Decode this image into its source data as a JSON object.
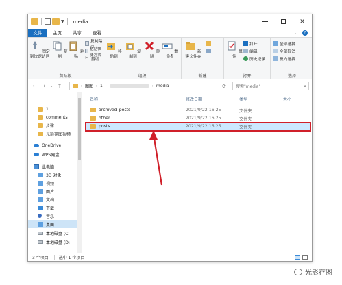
{
  "window": {
    "title": "media",
    "controls": {
      "minimize": "–",
      "maximize": "□",
      "close": "✕"
    }
  },
  "ribbon_tabs": [
    "文件",
    "主页",
    "共享",
    "查看"
  ],
  "ribbon": {
    "clipboard": {
      "label": "剪贴板",
      "pin_label": "固定到快速访问",
      "copy_label": "复制",
      "paste_label": "粘贴",
      "copy_path": "复制路径",
      "paste_shortcut": "粘贴快捷方式",
      "cut": "剪切"
    },
    "organize": {
      "label": "组织",
      "move_to": "移动到",
      "copy_to": "复制到",
      "delete": "删除",
      "rename": "重命名"
    },
    "new": {
      "label": "新建",
      "new_folder": "新建文件夹"
    },
    "open": {
      "label": "打开",
      "properties": "属性",
      "open": "打开",
      "edit": "编辑",
      "history": "历史记录"
    },
    "select": {
      "label": "选择",
      "select_all": "全部选择",
      "select_none": "全部取消",
      "invert": "反向选择"
    }
  },
  "address": {
    "crumbs": [
      "图图",
      "1",
      "media"
    ],
    "search_placeholder": "搜索\"media\""
  },
  "nav_pane": [
    {
      "label": "1",
      "icon": "folder-icon"
    },
    {
      "label": "comments",
      "icon": "folder-icon"
    },
    {
      "label": "步骤",
      "icon": "folder-icon"
    },
    {
      "label": "光影存图视频",
      "icon": "folder-icon"
    },
    {
      "label": "OneDrive",
      "icon": "cloud-icon"
    },
    {
      "label": "WPS网盘",
      "icon": "cloud-icon"
    },
    {
      "label": "此电脑",
      "icon": "pc-icon"
    },
    {
      "label": "3D 对象",
      "icon": "cube-icon"
    },
    {
      "label": "视频",
      "icon": "video-icon"
    },
    {
      "label": "图片",
      "icon": "picture-icon"
    },
    {
      "label": "文档",
      "icon": "document-icon"
    },
    {
      "label": "下载",
      "icon": "download-icon"
    },
    {
      "label": "音乐",
      "icon": "music-icon"
    },
    {
      "label": "桌面",
      "icon": "desktop-icon"
    },
    {
      "label": "本地磁盘 (C:",
      "icon": "disk-icon"
    },
    {
      "label": "本地磁盘 (D:",
      "icon": "disk-icon"
    }
  ],
  "columns": {
    "name": "名称",
    "date": "修改日期",
    "type": "类型",
    "size": "大小"
  },
  "files": [
    {
      "name": "archived_posts",
      "date": "2021/9/22 16:25",
      "type": "文件夹"
    },
    {
      "name": "other",
      "date": "2021/9/22 16:25",
      "type": "文件夹"
    },
    {
      "name": "posts",
      "date": "2021/9/22 16:25",
      "type": "文件夹"
    }
  ],
  "status": {
    "count": "3 个项目",
    "selected": "选中 1 个项目"
  },
  "watermark": "光影存图",
  "colors": {
    "accent": "#1a6fc0",
    "highlight": "#d0202a",
    "selection": "#cce8ff"
  }
}
